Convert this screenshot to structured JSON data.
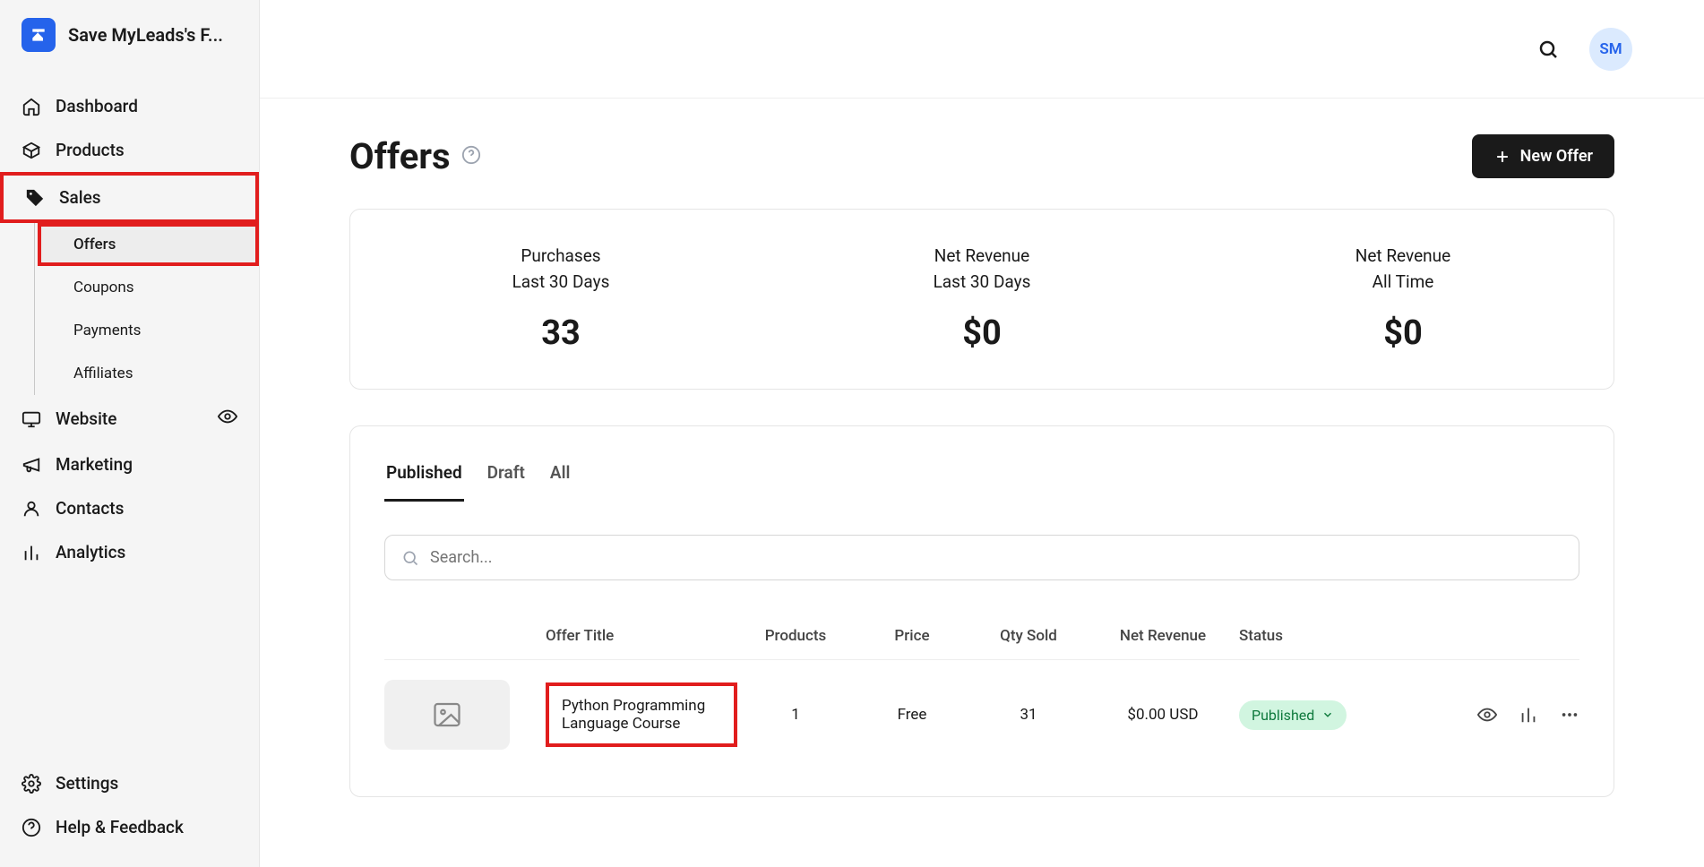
{
  "brand": {
    "title": "Save MyLeads's F..."
  },
  "sidebar": {
    "items": {
      "dashboard": "Dashboard",
      "products": "Products",
      "sales": "Sales",
      "website": "Website",
      "marketing": "Marketing",
      "contacts": "Contacts",
      "analytics": "Analytics",
      "settings": "Settings",
      "help": "Help & Feedback"
    },
    "sales_sub": {
      "offers": "Offers",
      "coupons": "Coupons",
      "payments": "Payments",
      "affiliates": "Affiliates"
    }
  },
  "topbar": {
    "avatar_initials": "SM"
  },
  "page": {
    "title": "Offers",
    "new_offer": "New Offer"
  },
  "stats": {
    "purchases": {
      "label": "Purchases",
      "sublabel": "Last 30 Days",
      "value": "33"
    },
    "net30": {
      "label": "Net Revenue",
      "sublabel": "Last 30 Days",
      "value": "$0"
    },
    "netall": {
      "label": "Net Revenue",
      "sublabel": "All Time",
      "value": "$0"
    }
  },
  "tabs": {
    "published": "Published",
    "draft": "Draft",
    "all": "All"
  },
  "search": {
    "placeholder": "Search..."
  },
  "table": {
    "headers": {
      "title": "Offer Title",
      "products": "Products",
      "price": "Price",
      "qty": "Qty Sold",
      "revenue": "Net Revenue",
      "status": "Status"
    },
    "rows": [
      {
        "title": "Python Programming Language Course",
        "products": "1",
        "price": "Free",
        "qty": "31",
        "revenue": "$0.00 USD",
        "status": "Published"
      }
    ]
  }
}
